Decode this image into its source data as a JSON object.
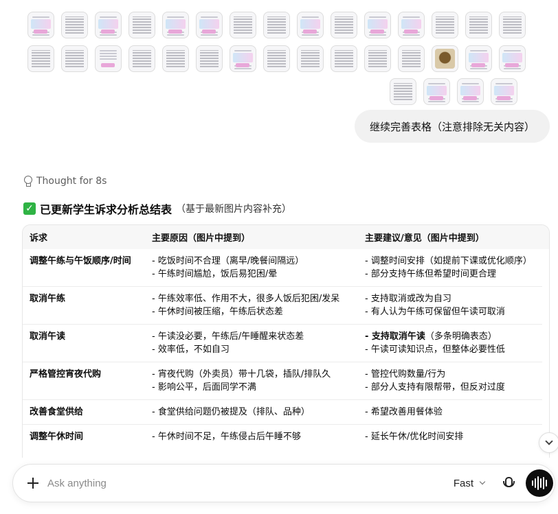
{
  "attachments": {
    "row1_kinds": [
      "blue",
      "blk",
      "blue",
      "blk",
      "blue",
      "blue",
      "blk",
      "blk",
      "blue",
      "blk",
      "blue",
      "blue",
      "blk",
      "blk",
      "blk"
    ],
    "row2_kinds": [
      "blk",
      "blk",
      "pink",
      "blk",
      "blk",
      "blk",
      "blue",
      "blk",
      "blk",
      "blk",
      "blk",
      "blk",
      "photo",
      "blue",
      "blue"
    ],
    "row3_kinds": [
      "blk",
      "blue",
      "blue",
      "blue"
    ]
  },
  "user_message": "继续完善表格（注意排除无关内容）",
  "thought_label": "Thought for 8s",
  "response": {
    "check_icon": "✓",
    "heading": "已更新学生诉求分析总结表",
    "heading_note": "（基于最新图片内容补充）",
    "table": {
      "headers": [
        "诉求",
        "主要原因（图片中提到）",
        "主要建议/意见（图片中提到）"
      ],
      "rows": [
        {
          "demand": "调整午练与午饭顺序/时间",
          "reasons": [
            "- 吃饭时间不合理（离早/晚餐间隔远）",
            "- 午练时间尴尬，饭后易犯困/晕"
          ],
          "suggestions": [
            "- 调整时间安排（如提前下课或优化顺序）",
            "- 部分支持午练但希望时间更合理"
          ]
        },
        {
          "demand": "取消午练",
          "reasons": [
            "- 午练效率低、作用不大，很多人饭后犯困/发呆",
            "- 午休时间被压缩，午练后状态差"
          ],
          "suggestions": [
            "- 支持取消或改为自习",
            "- 有人认为午练可保留但午读可取消"
          ]
        },
        {
          "demand": "取消午读",
          "reasons": [
            "- 午读没必要，午练后/午睡醒来状态差",
            "- 效率低，不如自习"
          ],
          "suggestions_bold": "- 支持取消午读",
          "suggestions_bold_rest": "（多条明确表态）",
          "suggestions": [
            "- 午读可读知识点，但整体必要性低"
          ]
        },
        {
          "demand": "严格管控宵夜代购",
          "reasons": [
            "- 宵夜代购（外卖员）带十几袋，插队/排队久",
            "- 影响公平，后面同学不满"
          ],
          "suggestions": [
            "- 管控代购数量/行为",
            "- 部分人支持有限帮带，但反对过度"
          ]
        },
        {
          "demand": "改善食堂供给",
          "reasons": [
            "- 食堂供给问题仍被提及（排队、品种）"
          ],
          "suggestions": [
            "- 希望改善用餐体验"
          ]
        },
        {
          "demand": "调整午休时间",
          "reasons": [
            "- 午休时间不足，午练侵占后午睡不够"
          ],
          "suggestions": [
            "- 延长午休/优化时间安排"
          ]
        }
      ]
    }
  },
  "composer": {
    "placeholder": "Ask anything",
    "mode": "Fast"
  }
}
